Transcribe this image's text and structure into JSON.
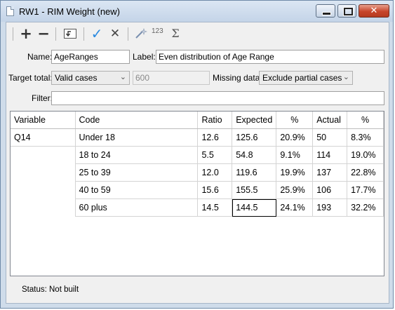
{
  "window": {
    "title": "RW1 - RIM Weight (new)",
    "close_glyph": "✕"
  },
  "toolbar": {
    "add_glyph": "+",
    "remove_glyph": "−",
    "ok_glyph": "✓",
    "cancel_glyph": "✕",
    "sum_glyph": "Σ",
    "numbers_glyph": "123"
  },
  "form": {
    "name_label": "Name:",
    "name_value": "AgeRanges",
    "label_label": "Label:",
    "label_value": "Even distribution of Age Range",
    "target_label": "Target total:",
    "target_value": "Valid cases",
    "target_number": "600",
    "missing_label": "Missing data:",
    "missing_value": "Exclude partial cases",
    "filter_label": "Filter:",
    "filter_value": ""
  },
  "table": {
    "headers": [
      "Variable",
      "Code",
      "Ratio",
      "Expected",
      "%",
      "Actual",
      "%"
    ],
    "rows": [
      [
        "Q14",
        "Under 18",
        "12.6",
        "125.6",
        "20.9%",
        "50",
        "8.3%"
      ],
      [
        "",
        "18 to 24",
        "5.5",
        "54.8",
        "9.1%",
        "114",
        "19.0%"
      ],
      [
        "",
        "25 to 39",
        "12.0",
        "119.6",
        "19.9%",
        "137",
        "22.8%"
      ],
      [
        "",
        "40 to 59",
        "15.6",
        "155.5",
        "25.9%",
        "106",
        "17.7%"
      ],
      [
        "",
        "60 plus",
        "14.5",
        "144.5",
        "24.1%",
        "193",
        "32.2%"
      ]
    ]
  },
  "status": {
    "text": "Status: Not built"
  }
}
